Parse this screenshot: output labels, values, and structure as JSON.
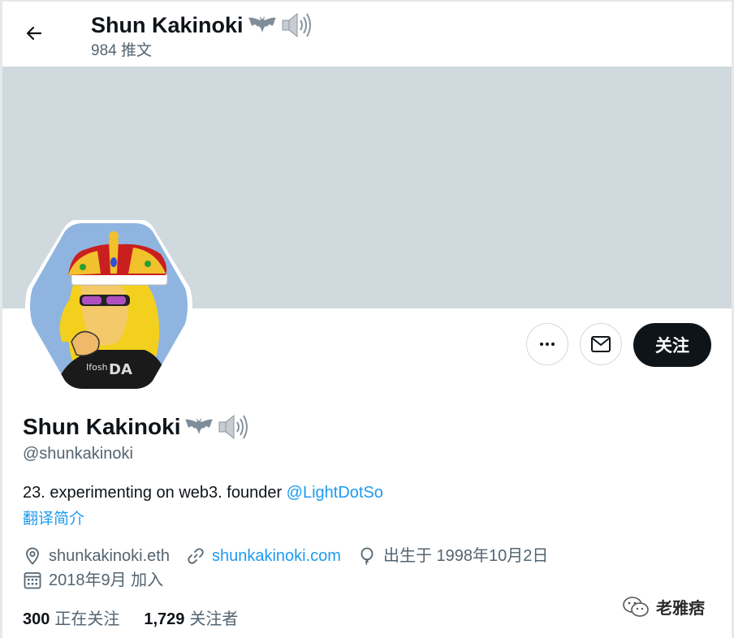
{
  "header": {
    "name": "Shun Kakinoki",
    "tweet_count": "984 推文"
  },
  "icons": {
    "back": "arrow-left-icon",
    "name_emoji": [
      "bat-icon",
      "speaker-icon"
    ]
  },
  "actions": {
    "more": "more-options-icon",
    "message": "envelope-icon",
    "follow_label": "关注"
  },
  "profile": {
    "display_name": "Shun Kakinoki",
    "handle": "@shunkakinoki",
    "bio_text": "23. experimenting on web3. founder ",
    "bio_mention": "@LightDotSo",
    "translate_label": "翻译简介",
    "location": "shunkakinoki.eth",
    "website": "shunkakinoki.com",
    "birthday": "出生于 1998年10月2日",
    "joined": "2018年9月 加入",
    "following_count": "300",
    "following_label": "正在关注",
    "followers_count": "1,729",
    "followers_label": "关注者"
  },
  "watermark": {
    "text": "老雅痞"
  },
  "colors": {
    "accent": "#1d9bf0",
    "banner": "#cfd9de",
    "secondary_text": "#536471",
    "follow_button": "#0f1419"
  }
}
